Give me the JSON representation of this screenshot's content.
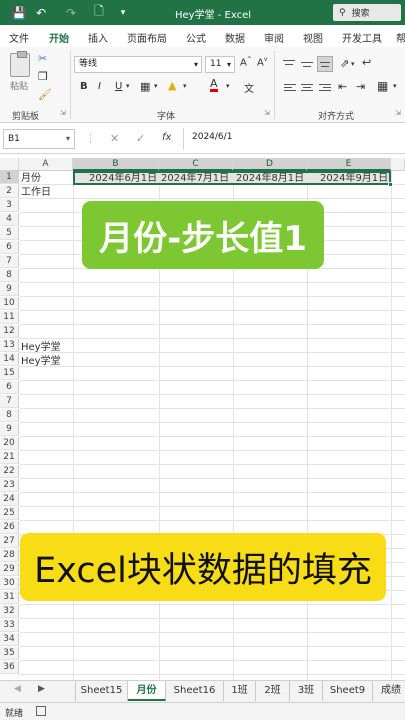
{
  "titlebar": {
    "title": "Hey学堂  -  Excel",
    "search_label": "搜索",
    "save_icon": "save-icon",
    "undo_icon": "undo-icon",
    "redo_icon": "redo-icon",
    "new_icon": "new-file-icon"
  },
  "ribbon_tabs": [
    "文件",
    "开始",
    "插入",
    "页面布局",
    "公式",
    "数据",
    "审阅",
    "视图",
    "开发工具",
    "帮"
  ],
  "active_tab": "开始",
  "ribbon": {
    "paste_label": "粘贴",
    "font_name": "等线",
    "font_size": "11",
    "groups": [
      "剪贴板",
      "字体",
      "对齐方式"
    ],
    "bold": "B",
    "italic": "I",
    "underline": "U"
  },
  "formula_bar": {
    "name_box": "B1",
    "formula": "2024/6/1",
    "fx_label": "fx"
  },
  "columns": [
    "A",
    "B",
    "C",
    "D",
    "E"
  ],
  "rows": [
    "1",
    "2",
    "3",
    "4",
    "5",
    "6",
    "7",
    "8",
    "9",
    "10",
    "11",
    "12",
    "13",
    "14",
    "15",
    "16",
    "17",
    "18",
    "19",
    "20",
    "21",
    "22",
    "23",
    "24",
    "25",
    "26",
    "27",
    "28",
    "29",
    "30",
    "31",
    "32",
    "33",
    "34",
    "35",
    "36"
  ],
  "row_labels_visible": [
    "1",
    "2",
    "3",
    "4",
    "5",
    "6",
    "7",
    "8",
    "9",
    "10",
    "11",
    "12",
    "13",
    "14",
    "15",
    "6",
    "7",
    "8",
    "9",
    "20",
    "21",
    "22",
    "23",
    "24",
    "25",
    "26",
    "27",
    "28",
    "29",
    "30",
    "31",
    "32",
    "33",
    "34",
    "35",
    "36"
  ],
  "cells": {
    "A1": "月份",
    "A2": "工作日",
    "B1": "2024年6月1日",
    "C1": "2024年7月1日",
    "D1": "2024年8月1日",
    "E1": "2024年9月1日",
    "A13": "Hey学堂",
    "A14": "Hey学堂"
  },
  "banners": {
    "top": "月份-步长值1",
    "bottom": "Excel块状数据的填充"
  },
  "colors": {
    "excel_green": "#217346",
    "banner_green": "#7dc832",
    "banner_yellow": "#f7dc16"
  },
  "sheet_tabs": [
    "Sheet15",
    "月份",
    "Sheet16",
    "1班",
    "2班",
    "3班",
    "Sheet9",
    "成绩表"
  ],
  "active_sheet": "月份",
  "status": {
    "text": "就绪"
  }
}
